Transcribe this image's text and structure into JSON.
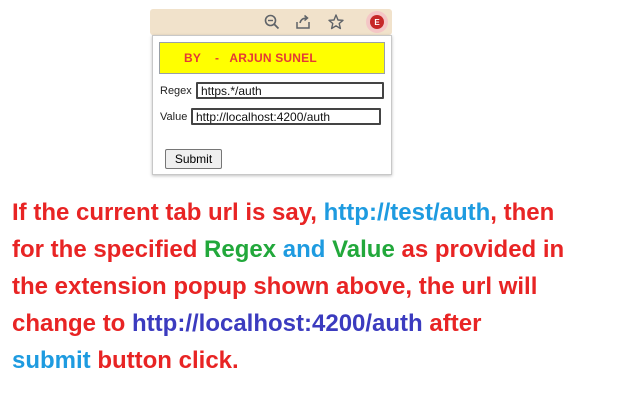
{
  "toolbar": {
    "icons": [
      "zoom-icon",
      "share-icon",
      "star-icon"
    ],
    "extension_badge": "E"
  },
  "popup": {
    "banner": "BY    -   ARJUN SUNEL",
    "regex_label": "Regex",
    "regex_value": "https.*/auth",
    "value_label": "Value",
    "value_value": "http://localhost:4200/auth",
    "submit_label": "Submit"
  },
  "caption": {
    "line1_a": "If the current tab url is say, ",
    "line1_url": "http://test/auth",
    "line1_b": ", then",
    "line2_a": "for the specified ",
    "line2_regex": "Regex",
    "line2_and": " and ",
    "line2_value": "Value",
    "line2_b": " as provided in",
    "line3": "the extension popup shown above, the url will",
    "line4_a": "change to ",
    "line4_url": "http://localhost:4200/auth",
    "line4_b": " after",
    "line5_submit": "submit",
    "line5_b": " button click."
  },
  "colors": {
    "caption_red": "#e82424",
    "link_blue": "#1e9be0",
    "green": "#22a83b",
    "navy": "#3b3bbf",
    "banner_yellow": "#ffff00",
    "banner_text_red": "#e53935"
  }
}
